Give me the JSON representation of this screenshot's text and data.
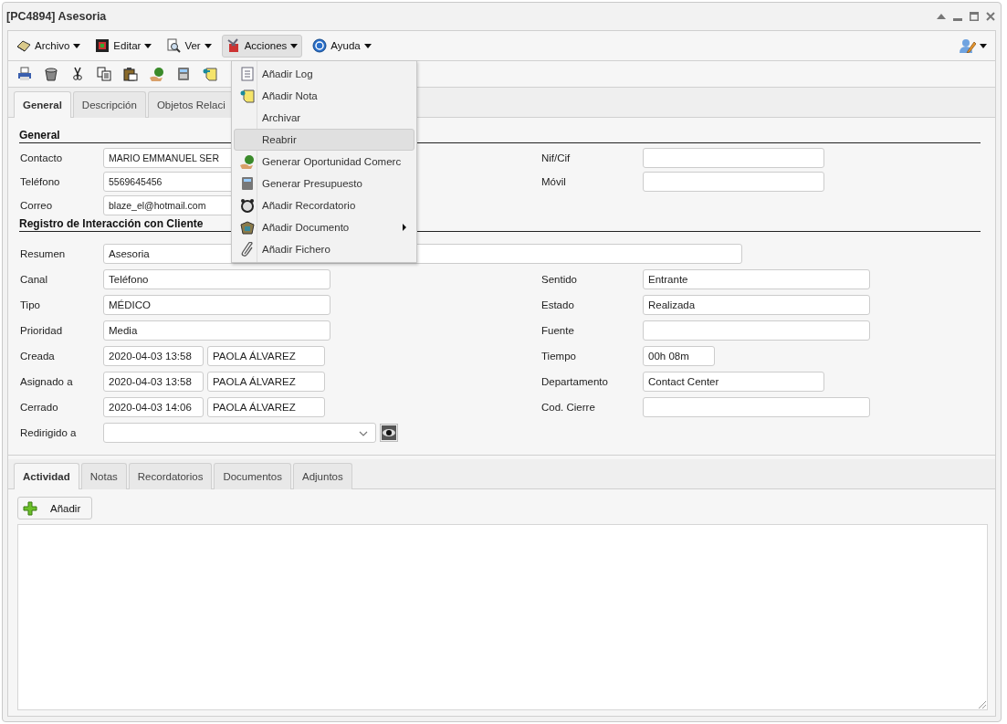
{
  "window": {
    "title": "[PC4894] Asesoria"
  },
  "menubar": [
    {
      "label": "Archivo",
      "selected": false
    },
    {
      "label": "Editar",
      "selected": false
    },
    {
      "label": "Ver",
      "selected": false
    },
    {
      "label": "Acciones",
      "selected": true
    },
    {
      "label": "Ayuda",
      "selected": false
    }
  ],
  "tabs": [
    {
      "label": "General",
      "selected": true
    },
    {
      "label": "Descripción",
      "selected": false
    },
    {
      "label": "Objetos Relaci",
      "selected": false
    }
  ],
  "general": {
    "title": "General",
    "rows": [
      {
        "label": "Contacto",
        "value": "MARIO EMMANUEL SER",
        "right_label": "Nif/Cif"
      },
      {
        "label": "Teléfono",
        "value": "5569645456",
        "right_label": "Móvil"
      },
      {
        "label": "Correo",
        "value": "blaze_el@hotmail.com"
      }
    ]
  },
  "registro": {
    "title": "Registro de Interacción con Cliente",
    "rows": [
      {
        "label": "Resumen",
        "fields": [
          {
            "kind": "wide",
            "value": "Asesoria"
          }
        ]
      },
      {
        "label": "Canal",
        "fields": [
          {
            "kind": "medium",
            "value": "Teléfono"
          }
        ],
        "right_label": "Sentido",
        "right_field": {
          "kind": "medium",
          "value": "Entrante"
        }
      },
      {
        "label": "Tipo",
        "fields": [
          {
            "kind": "medium",
            "value": "MÉDICO"
          }
        ],
        "right_label": "Estado",
        "right_field": {
          "kind": "medium",
          "value": "Realizada"
        }
      },
      {
        "label": "Prioridad",
        "fields": [
          {
            "kind": "medium",
            "value": "Media"
          }
        ],
        "right_label": "Fuente",
        "right_field": {
          "kind": "medium"
        }
      },
      {
        "label": "Creada",
        "fields": [
          {
            "kind": "date",
            "value": "2020-04-03 13:58"
          },
          {
            "kind": "name",
            "value": "PAOLA ÁLVAREZ"
          }
        ],
        "right_label": "Tiempo",
        "right_field": {
          "kind": "short",
          "value": "00h 08m"
        }
      },
      {
        "label": "Asignado a",
        "fields": [
          {
            "kind": "date",
            "value": "2020-04-03 13:58"
          },
          {
            "kind": "name",
            "value": "PAOLA ÁLVAREZ"
          }
        ],
        "right_label": "Departamento",
        "right_field": {
          "kind": "dept",
          "value": "Contact Center"
        }
      },
      {
        "label": "Cerrado",
        "fields": [
          {
            "kind": "date",
            "value": "2020-04-03 14:06"
          },
          {
            "kind": "name",
            "value": "PAOLA ÁLVAREZ"
          }
        ],
        "right_label": "Cod. Cierre",
        "right_field": {
          "kind": "medium"
        }
      },
      {
        "label": "Redirigido a",
        "fields": [
          {
            "kind": "select"
          }
        ]
      }
    ]
  },
  "actions_menu": [
    {
      "label": "Añadir Log",
      "selected": false,
      "submenu": false
    },
    {
      "label": "Añadir Nota",
      "selected": false,
      "submenu": false
    },
    {
      "label": "Archivar",
      "selected": false,
      "submenu": false
    },
    {
      "label": "Reabrir",
      "selected": true,
      "submenu": false
    },
    {
      "label": "Generar Oportunidad Comerc",
      "selected": false,
      "submenu": false
    },
    {
      "label": "Generar Presupuesto",
      "selected": false,
      "submenu": false
    },
    {
      "label": "Añadir Recordatorio",
      "selected": false,
      "submenu": false
    },
    {
      "label": "Añadir Documento",
      "selected": false,
      "submenu": true
    },
    {
      "label": "Añadir Fichero",
      "selected": false,
      "submenu": false
    }
  ],
  "bottom_tabs": [
    {
      "label": "Actividad",
      "selected": true
    },
    {
      "label": "Notas",
      "selected": false
    },
    {
      "label": "Recordatorios",
      "selected": false
    },
    {
      "label": "Documentos",
      "selected": false
    },
    {
      "label": "Adjuntos",
      "selected": false
    }
  ],
  "add_button": "Añadir"
}
